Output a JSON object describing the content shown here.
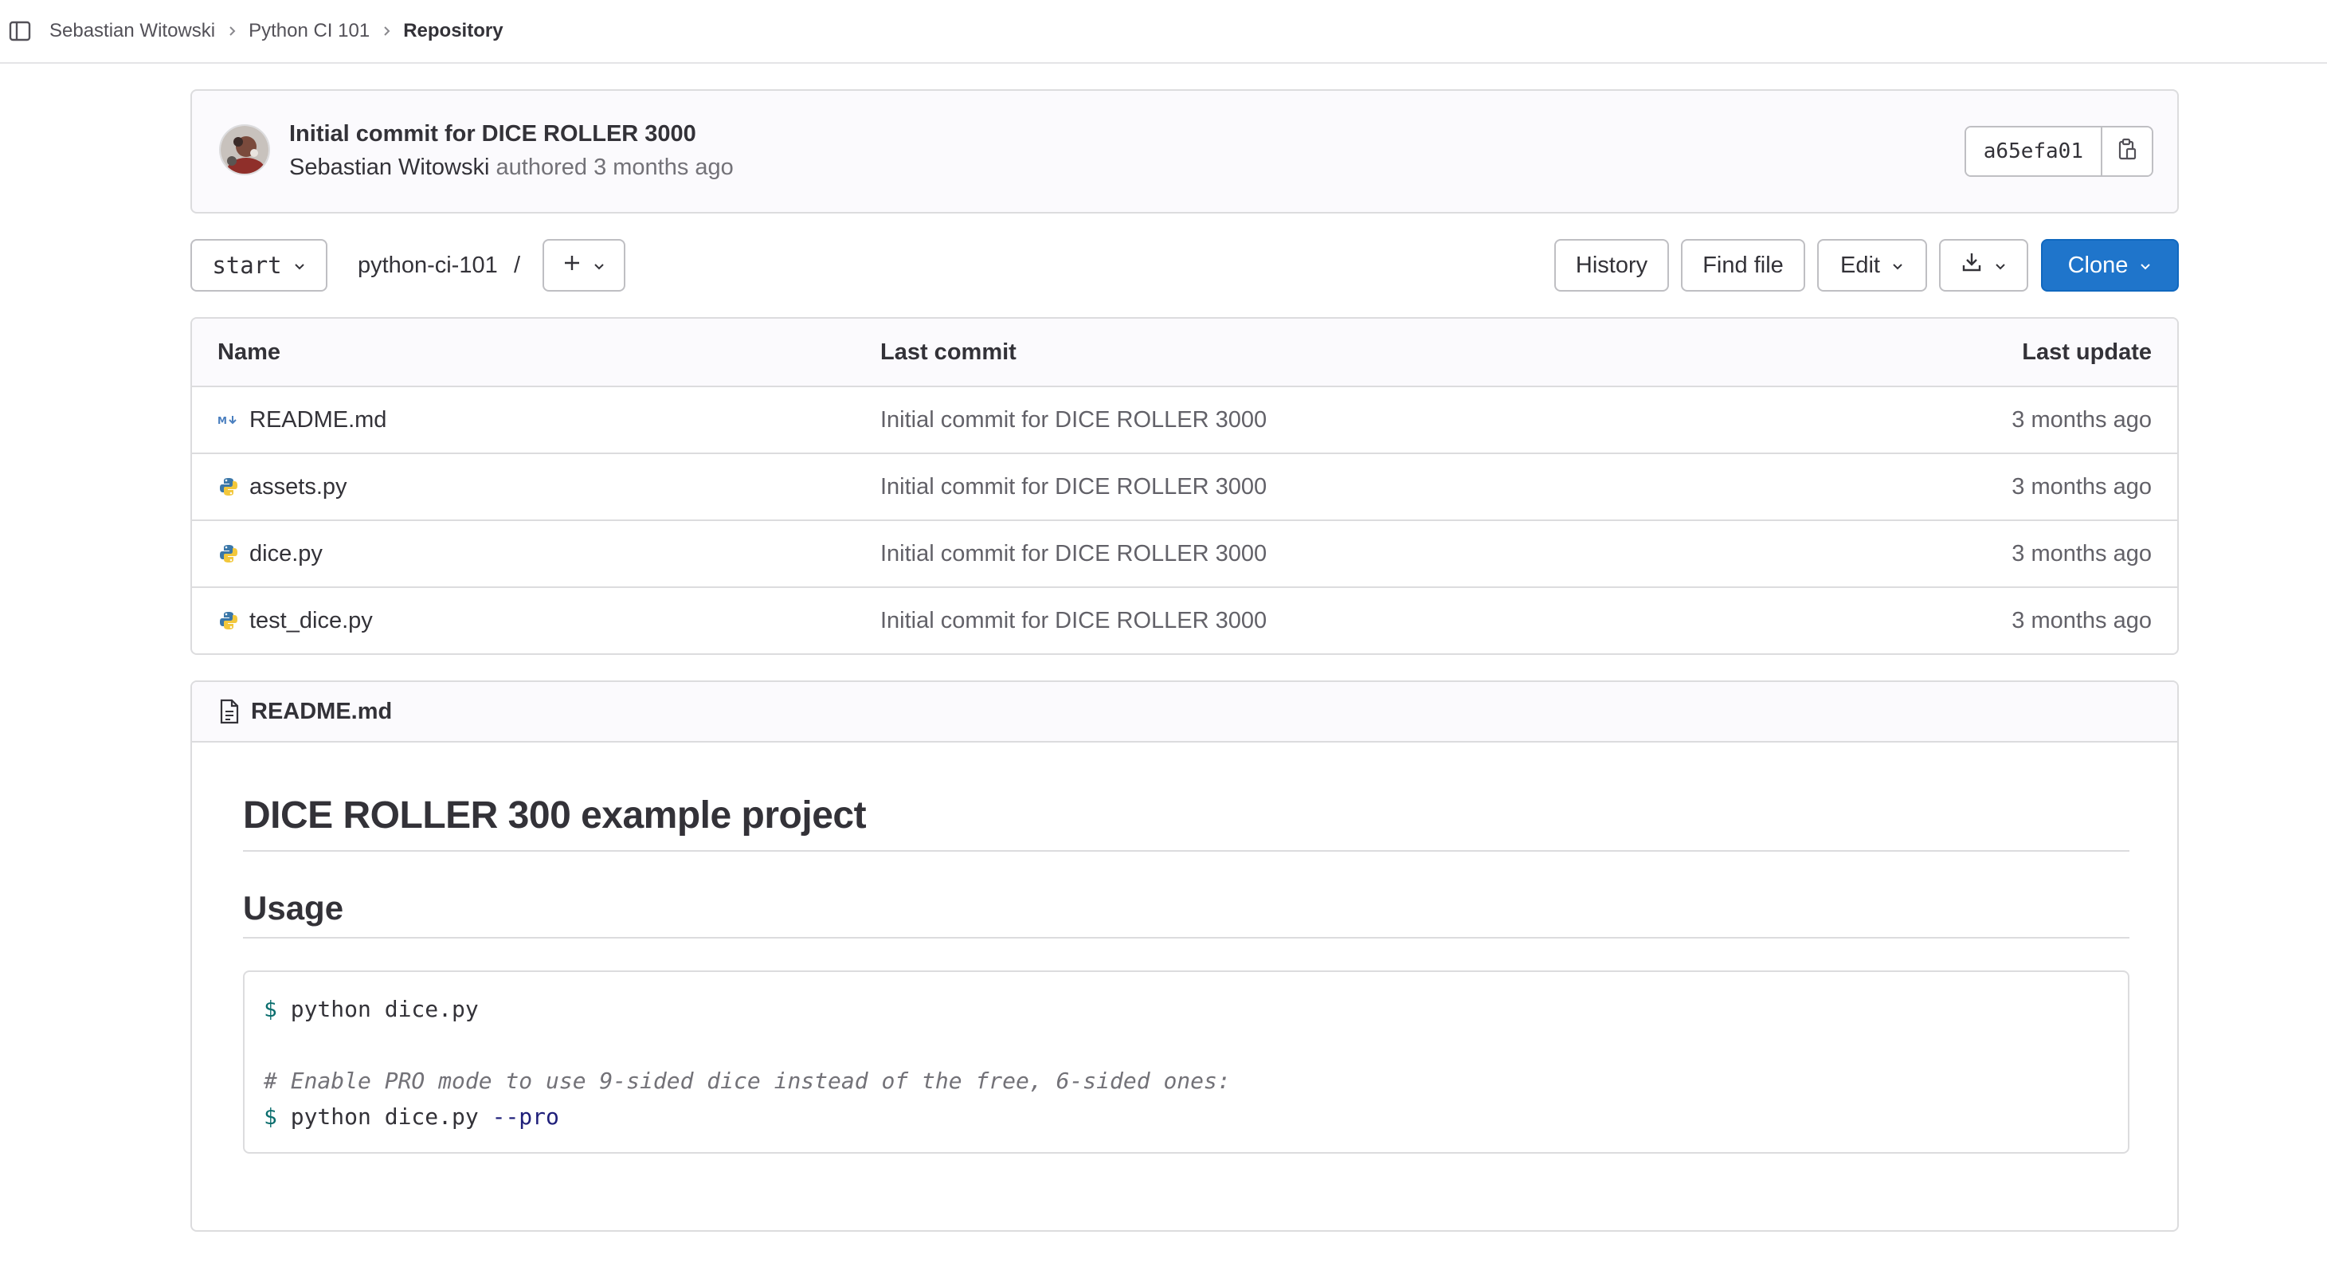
{
  "breadcrumb": {
    "items": [
      "Sebastian Witowski",
      "Python CI 101"
    ],
    "current": "Repository"
  },
  "commit": {
    "title": "Initial commit for DICE ROLLER 3000",
    "author": "Sebastian Witowski",
    "action": "authored",
    "time": "3 months ago",
    "sha": "a65efa01"
  },
  "toolbar": {
    "branch": "start",
    "path": "python-ci-101",
    "path_sep": "/",
    "history": "History",
    "find_file": "Find file",
    "edit": "Edit",
    "clone": "Clone"
  },
  "table": {
    "headers": {
      "name": "Name",
      "last_commit": "Last commit",
      "last_update": "Last update"
    },
    "rows": [
      {
        "icon": "markdown-icon",
        "name": "README.md",
        "commit": "Initial commit for DICE ROLLER 3000",
        "updated": "3 months ago"
      },
      {
        "icon": "python-icon",
        "name": "assets.py",
        "commit": "Initial commit for DICE ROLLER 3000",
        "updated": "3 months ago"
      },
      {
        "icon": "python-icon",
        "name": "dice.py",
        "commit": "Initial commit for DICE ROLLER 3000",
        "updated": "3 months ago"
      },
      {
        "icon": "python-icon",
        "name": "test_dice.py",
        "commit": "Initial commit for DICE ROLLER 3000",
        "updated": "3 months ago"
      }
    ]
  },
  "readme": {
    "filename": "README.md",
    "h1": "DICE ROLLER 300 example project",
    "h2": "Usage",
    "code": {
      "prompt": "$",
      "line1_cmd": "python dice.py",
      "comment": "# Enable PRO mode to use 9-sided dice instead of the free, 6-sided ones:",
      "line3_cmd": "python dice.py",
      "line3_flag": "--pro"
    }
  },
  "colors": {
    "primary": "#1f75cb",
    "border": "#dcdcde",
    "text": "#333238",
    "muted": "#737278"
  }
}
